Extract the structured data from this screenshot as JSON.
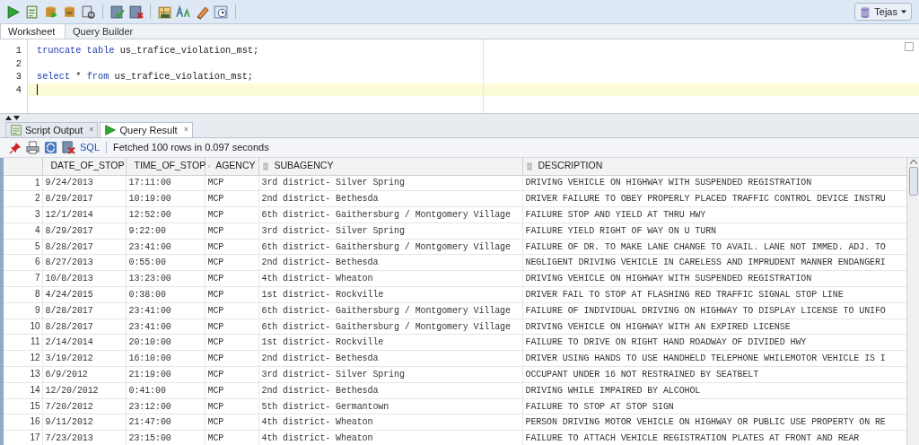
{
  "connection": {
    "label": "Tejas"
  },
  "editor_tabs": [
    {
      "label": "Worksheet",
      "selected": true
    },
    {
      "label": "Query Builder",
      "selected": false
    }
  ],
  "editor": {
    "lines": [
      {
        "number": "1",
        "current": false,
        "tokens": [
          {
            "text": "truncate",
            "kind": "keyword"
          },
          {
            "text": " table",
            "kind": "keyword"
          },
          {
            "text": " us_trafice_violation_mst;",
            "kind": "plain"
          }
        ]
      },
      {
        "number": "2",
        "current": false
      },
      {
        "number": "3",
        "current": false,
        "tokens": [
          {
            "text": "select",
            "kind": "keyword"
          },
          {
            "text": " * ",
            "kind": "plain"
          },
          {
            "text": "from",
            "kind": "keyword"
          },
          {
            "text": " us_trafice_violation_mst;",
            "kind": "plain"
          }
        ]
      },
      {
        "number": "4",
        "current": true
      }
    ]
  },
  "result_tabs": [
    {
      "label": "Script Output",
      "close": "×",
      "selected": false,
      "kind": "script"
    },
    {
      "label": "Query Result",
      "close": "×",
      "selected": true,
      "kind": "query"
    }
  ],
  "result_toolbar": {
    "sql_link": "SQL",
    "status": "Fetched 100 rows in 0.097 seconds"
  },
  "table": {
    "columns": [
      "DATE_OF_STOP",
      "TIME_OF_STOP",
      "AGENCY",
      "SUBAGENCY",
      "DESCRIPTION"
    ],
    "rows": [
      {
        "number": "1",
        "cells": [
          "9/24/2013",
          "17:11:00",
          "MCP",
          "3rd district- Silver Spring",
          "DRIVING VEHICLE ON HIGHWAY WITH SUSPENDED REGISTRATION"
        ]
      },
      {
        "number": "2",
        "cells": [
          "8/29/2017",
          "10:19:00",
          "MCP",
          "2nd district- Bethesda",
          "DRIVER FAILURE TO OBEY PROPERLY PLACED TRAFFIC CONTROL DEVICE INSTRU"
        ]
      },
      {
        "number": "3",
        "cells": [
          "12/1/2014",
          "12:52:00",
          "MCP",
          "6th district- Gaithersburg / Montgomery Village",
          "FAILURE STOP AND YIELD AT THRU HWY"
        ]
      },
      {
        "number": "4",
        "cells": [
          "8/29/2017",
          "9:22:00",
          "MCP",
          "3rd district- Silver Spring",
          "FAILURE YIELD RIGHT OF WAY ON U TURN"
        ]
      },
      {
        "number": "5",
        "cells": [
          "8/28/2017",
          "23:41:00",
          "MCP",
          "6th district- Gaithersburg / Montgomery Village",
          "FAILURE OF DR. TO MAKE LANE CHANGE TO AVAIL. LANE NOT IMMED. ADJ. TO"
        ]
      },
      {
        "number": "6",
        "cells": [
          "8/27/2013",
          "0:55:00",
          "MCP",
          "2nd district- Bethesda",
          "NEGLIGENT DRIVING VEHICLE IN CARELESS AND IMPRUDENT MANNER ENDANGERI"
        ]
      },
      {
        "number": "7",
        "cells": [
          "10/8/2013",
          "13:23:00",
          "MCP",
          "4th district- Wheaton",
          "DRIVING VEHICLE ON HIGHWAY WITH SUSPENDED REGISTRATION"
        ]
      },
      {
        "number": "8",
        "cells": [
          "4/24/2015",
          "0:38:00",
          "MCP",
          "1st district- Rockville",
          "DRIVER FAIL TO STOP AT FLASHING RED TRAFFIC SIGNAL STOP LINE"
        ]
      },
      {
        "number": "9",
        "cells": [
          "8/28/2017",
          "23:41:00",
          "MCP",
          "6th district- Gaithersburg / Montgomery Village",
          "FAILURE OF INDIVIDUAL DRIVING ON HIGHWAY TO DISPLAY LICENSE TO UNIFO"
        ]
      },
      {
        "number": "10",
        "cells": [
          "8/28/2017",
          "23:41:00",
          "MCP",
          "6th district- Gaithersburg / Montgomery Village",
          "DRIVING VEHICLE ON HIGHWAY WITH AN EXPIRED LICENSE"
        ]
      },
      {
        "number": "11",
        "cells": [
          "2/14/2014",
          "20:10:00",
          "MCP",
          "1st district- Rockville",
          "FAILURE TO DRIVE ON RIGHT HAND ROADWAY OF DIVIDED HWY"
        ]
      },
      {
        "number": "12",
        "cells": [
          "3/19/2012",
          "16:10:00",
          "MCP",
          "2nd district- Bethesda",
          "DRIVER USING HANDS TO USE HANDHELD TELEPHONE WHILEMOTOR VEHICLE IS I"
        ]
      },
      {
        "number": "13",
        "cells": [
          "6/9/2012",
          "21:19:00",
          "MCP",
          "3rd district- Silver Spring",
          "OCCUPANT UNDER 16 NOT RESTRAINED BY SEATBELT"
        ]
      },
      {
        "number": "14",
        "cells": [
          "12/20/2012",
          "0:41:00",
          "MCP",
          "2nd district- Bethesda",
          "DRIVING WHILE IMPAIRED BY ALCOHOL"
        ]
      },
      {
        "number": "15",
        "cells": [
          "7/20/2012",
          "23:12:00",
          "MCP",
          "5th district- Germantown",
          "FAILURE TO STOP AT STOP SIGN"
        ]
      },
      {
        "number": "16",
        "cells": [
          "9/11/2012",
          "21:47:00",
          "MCP",
          "4th district- Wheaton",
          "PERSON DRIVING MOTOR VEHICLE ON HIGHWAY OR PUBLIC USE PROPERTY ON RE"
        ]
      },
      {
        "number": "17",
        "cells": [
          "7/23/2013",
          "23:15:00",
          "MCP",
          "4th district- Wheaton",
          "FAILURE TO ATTACH VEHICLE REGISTRATION PLATES AT FRONT AND REAR"
        ]
      }
    ]
  }
}
